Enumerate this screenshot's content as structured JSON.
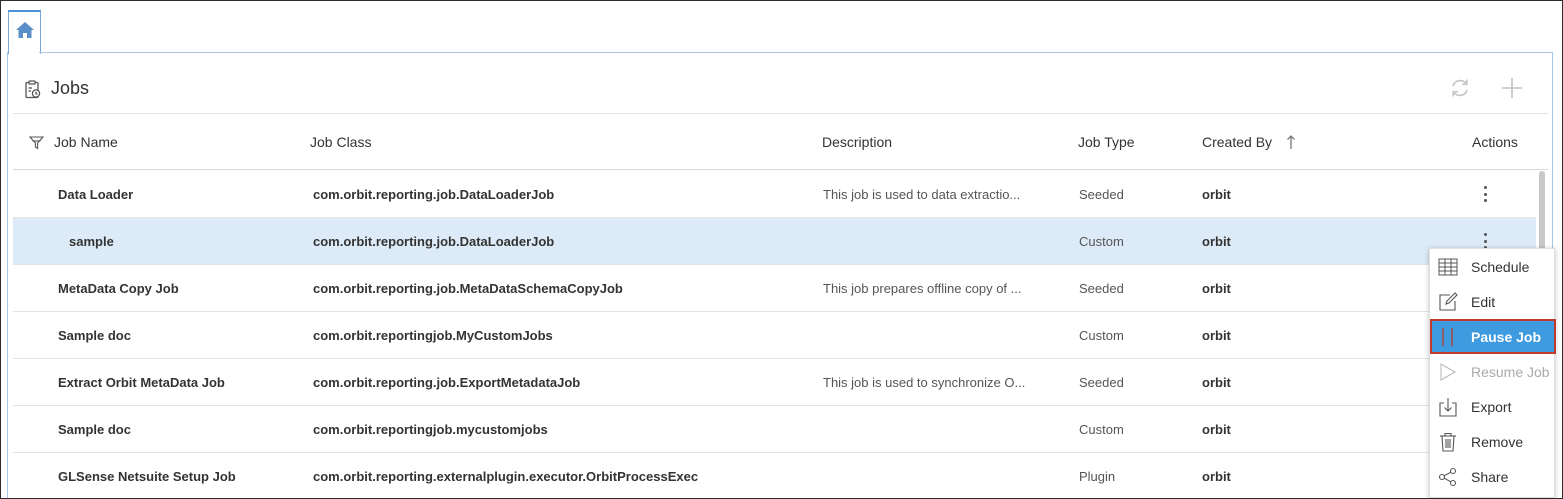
{
  "header": {
    "title": "Jobs",
    "title_icon": "clipboard-clock-icon",
    "refresh_icon": "refresh-icon",
    "add_icon": "plus-icon"
  },
  "columns": {
    "job_name": "Job Name",
    "job_class": "Job Class",
    "description": "Description",
    "job_type": "Job Type",
    "created_by": "Created By",
    "actions": "Actions"
  },
  "rows": [
    {
      "name": "Data Loader",
      "class": "com.orbit.reporting.job.DataLoaderJob",
      "description": "This job is used to data extractio...",
      "type": "Seeded",
      "created_by": "orbit"
    },
    {
      "name": "sample",
      "class": "com.orbit.reporting.job.DataLoaderJob",
      "description": "",
      "type": "Custom",
      "created_by": "orbit"
    },
    {
      "name": "MetaData Copy Job",
      "class": "com.orbit.reporting.job.MetaDataSchemaCopyJob",
      "description": "This job prepares offline copy of ...",
      "type": "Seeded",
      "created_by": "orbit"
    },
    {
      "name": "Sample doc",
      "class": "com.orbit.reportingjob.MyCustomJobs",
      "description": "",
      "type": "Custom",
      "created_by": "orbit"
    },
    {
      "name": "Extract Orbit MetaData Job",
      "class": "com.orbit.reporting.job.ExportMetadataJob",
      "description": "This job is used to synchronize O...",
      "type": "Seeded",
      "created_by": "orbit"
    },
    {
      "name": "Sample doc",
      "class": "com.orbit.reportingjob.mycustomjobs",
      "description": "",
      "type": "Custom",
      "created_by": "orbit"
    },
    {
      "name": "GLSense Netsuite Setup Job",
      "class": "com.orbit.reporting.externalplugin.executor.OrbitProcessExec",
      "description": "",
      "type": "Plugin",
      "created_by": "orbit"
    }
  ],
  "context_menu": {
    "items": [
      {
        "label": "Schedule",
        "icon": "calendar-grid-icon"
      },
      {
        "label": "Edit",
        "icon": "edit-icon"
      },
      {
        "label": "Pause Job",
        "icon": "pause-icon"
      },
      {
        "label": "Resume Job",
        "icon": "play-icon"
      },
      {
        "label": "Export",
        "icon": "export-icon"
      },
      {
        "label": "Remove",
        "icon": "trash-icon"
      },
      {
        "label": "Share",
        "icon": "share-icon"
      }
    ]
  },
  "colors": {
    "selected_row": "#ddebf8",
    "menu_active": "#3f9be0",
    "active_outline": "#c0392b",
    "tab_accent": "#4a90d9"
  }
}
